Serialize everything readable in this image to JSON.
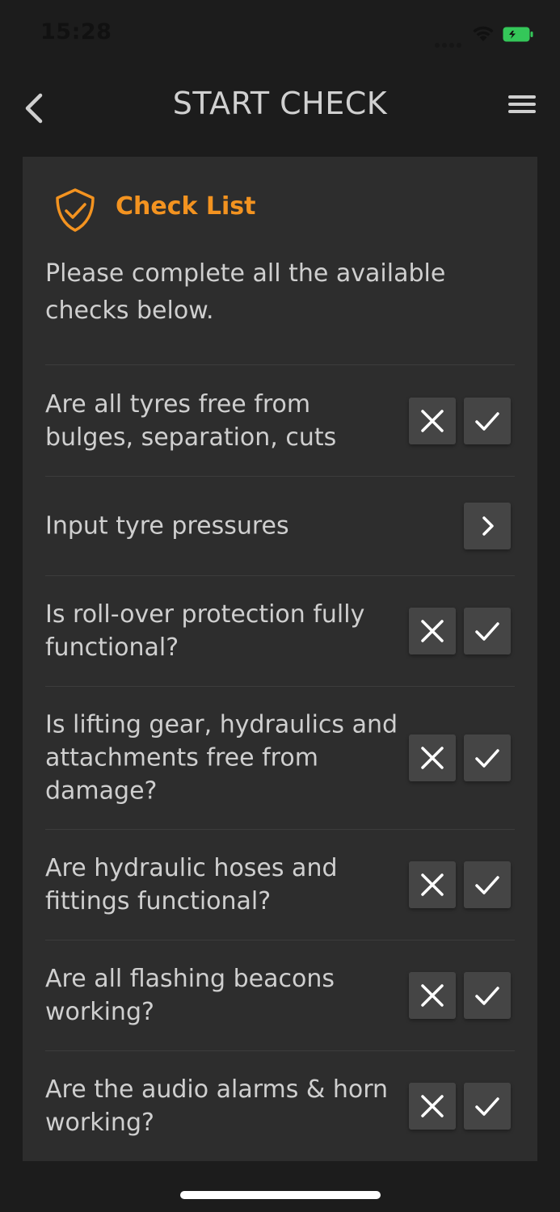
{
  "status_bar": {
    "time": "15:28"
  },
  "nav": {
    "title": "START CHECK"
  },
  "card": {
    "title": "Check List",
    "instructions": "Please complete all the available checks below."
  },
  "checks": [
    {
      "label": "Are all tyres free from bulges, separation, cuts",
      "type": "pass-fail"
    },
    {
      "label": "Input tyre pressures",
      "type": "navigate"
    },
    {
      "label": "Is roll-over protection fully functional?",
      "type": "pass-fail"
    },
    {
      "label": "Is lifting gear, hydraulics and attachments free from damage?",
      "type": "pass-fail"
    },
    {
      "label": "Are hydraulic hoses and fittings functional?",
      "type": "pass-fail"
    },
    {
      "label": "Are all flashing beacons working?",
      "type": "pass-fail"
    },
    {
      "label": "Are the audio alarms & horn working?",
      "type": "pass-fail"
    }
  ],
  "colors": {
    "background": "#1c1c1c",
    "card": "#2d2d2d",
    "accent": "#f39320",
    "button": "#454545",
    "battery": "#34c759"
  },
  "icons": {
    "back": "chevron-left-icon",
    "menu": "hamburger-menu-icon",
    "header": "shield-check-icon",
    "fail": "x-icon",
    "pass": "checkmark-icon",
    "navigate": "chevron-right-icon"
  }
}
